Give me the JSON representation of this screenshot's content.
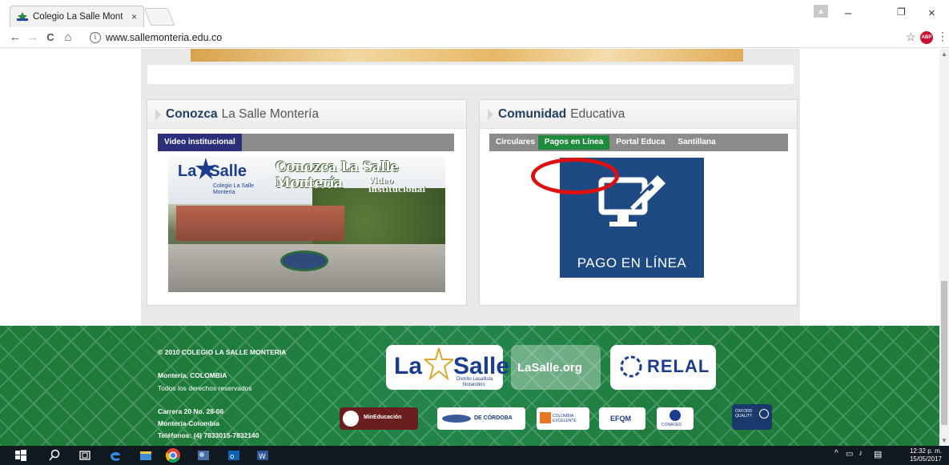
{
  "browser": {
    "tab_title": "Colegio La Salle Monterí",
    "tab_close": "×",
    "url": "www.sallemonteria.edu.co",
    "info_icon": "i",
    "abp_label": "ABP",
    "win_minimize": "–",
    "win_restore": "❐",
    "win_close": "×",
    "nav_back": "←",
    "nav_forward": "→",
    "nav_reload": "C",
    "nav_home": "⌂",
    "star": "☆",
    "menu": "⋮"
  },
  "page": {
    "left_panel": {
      "title_strong": "Conozca",
      "title_light": "La Salle Montería",
      "tab_label": "Video institucional",
      "video_title": "Conozca La Salle Montería",
      "video_subtitle": "Video institucional",
      "logo_text_la": "La",
      "logo_text_salle": "Salle",
      "logo_sub_1": "Colegio La Salle",
      "logo_sub_2": "Montería"
    },
    "right_panel": {
      "title_strong": "Comunidad",
      "title_light": "Educativa",
      "tabs": [
        "Circulares",
        "Pagos en Línea",
        "Portal Educa",
        "Santillana"
      ],
      "active_tab": "Pagos en Línea",
      "pago_text": "PAGO EN LÍNEA"
    }
  },
  "footer": {
    "copyright": "© 2010 COLEGIO LA SALLE MONTERIA",
    "city": "Montería, COLOMBIA",
    "rights": "Todos los derechos reservados",
    "address": "Carrera 20 No. 28-06",
    "city2": "Montería-Colombia",
    "phones": "Teléfonos: (4) 7833015-7832140",
    "logos": {
      "lasalle_la": "La",
      "lasalle_salle": "Salle",
      "lasalle_sub_1": "Distrito Lasallista",
      "lasalle_sub_2": "Norandino",
      "lasalleorg": "LaSalle.org",
      "relal": "RELAL",
      "mineducacion": "MinEducación",
      "cordoba": "DE CÓRDOBA",
      "colombia_excelente": "COLOMBIA EXCELENTE",
      "efqm": "EFQM",
      "conaced": "CONACED",
      "oxford": "OXFORD QUALITY"
    }
  },
  "taskbar": {
    "time": "12:32 p. m.",
    "date": "15/05/2017"
  },
  "colors": {
    "footer_green": "#1e7b3a",
    "active_tab_green": "#1e8a3b",
    "active_tab_blue": "#2c2f7a",
    "pago_blue": "#1e4a84",
    "highlight_red": "#e01010"
  }
}
